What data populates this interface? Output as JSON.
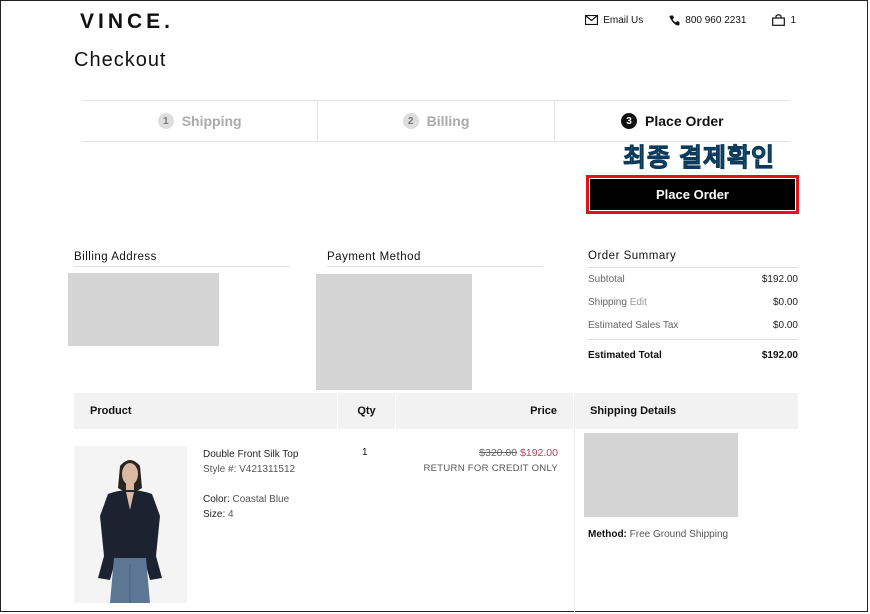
{
  "brand": "VINCE.",
  "header": {
    "email_label": "Email Us",
    "phone": "800 960 2231",
    "cart_count": "1"
  },
  "page_title": "Checkout",
  "steps": [
    {
      "num": "1",
      "label": "Shipping"
    },
    {
      "num": "2",
      "label": "Billing"
    },
    {
      "num": "3",
      "label": "Place Order"
    }
  ],
  "annotation": "최종 결제확인",
  "place_order_label": "Place Order",
  "billing_title": "Billing Address",
  "payment_title": "Payment Method",
  "summary": {
    "title": "Order Summary",
    "subtotal_label": "Subtotal",
    "subtotal": "$192.00",
    "shipping_label": "Shipping",
    "shipping_edit": "Edit",
    "shipping": "$0.00",
    "tax_label": "Estimated Sales Tax",
    "tax": "$0.00",
    "total_label": "Estimated Total",
    "total": "$192.00"
  },
  "table": {
    "product": "Product",
    "qty": "Qty",
    "price": "Price",
    "shipping_details": "Shipping Details"
  },
  "item": {
    "name": "Double Front Silk Top",
    "style": "Style #: V421311512",
    "color_label": "Color:",
    "color": "Coastal Blue",
    "size_label": "Size:",
    "size": "4",
    "qty": "1",
    "old_price": "$320.00",
    "price": "$192.00",
    "note": "RETURN FOR CREDIT ONLY"
  },
  "method_label": "Method:",
  "method_value": "Free Ground Shipping",
  "colors": {
    "accent_red": "#e0121a",
    "annotation": "#38b7e3",
    "sale": "#b0485b"
  }
}
